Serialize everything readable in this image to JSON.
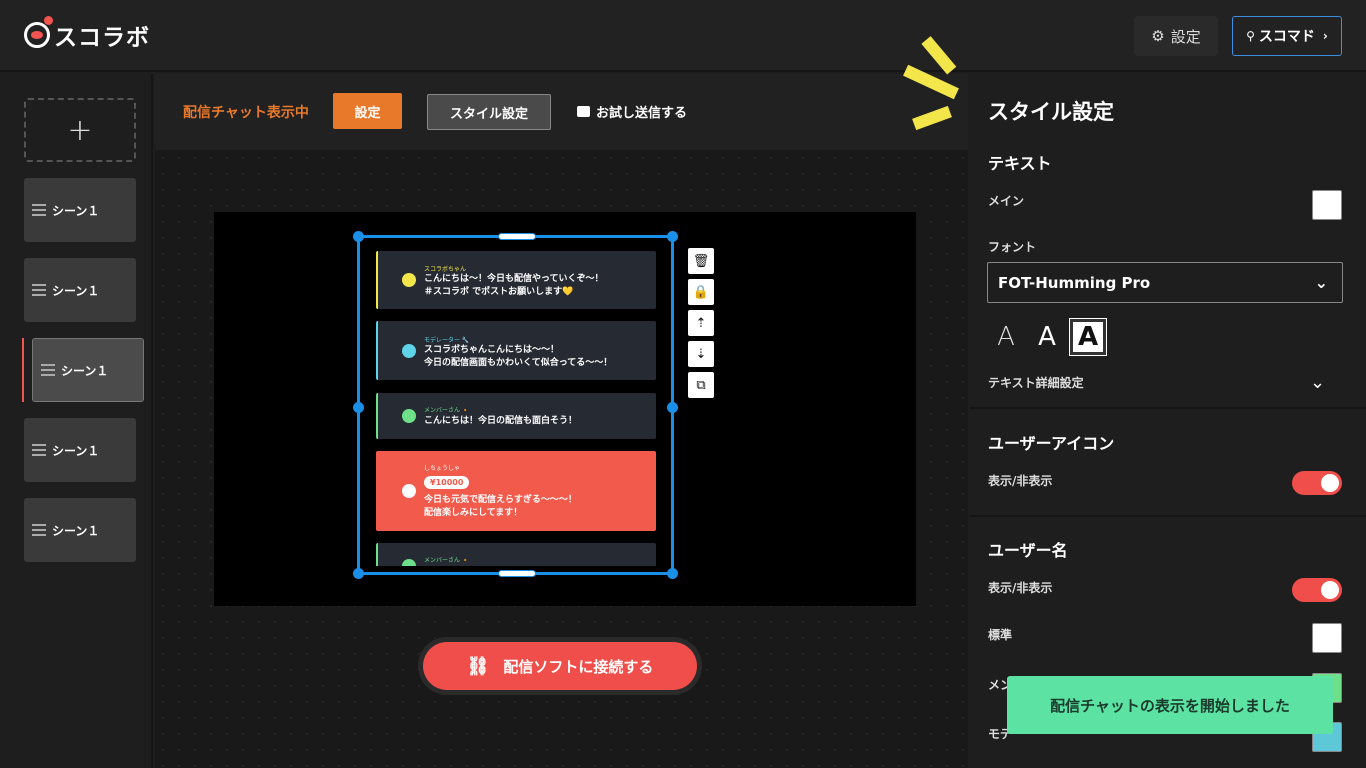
{
  "header": {
    "logo_text": "スコラボ",
    "settings_label": "設定",
    "scmd_label": "スコマド"
  },
  "sidebar": {
    "add_label": "+",
    "scenes": [
      {
        "label": "シーン１"
      },
      {
        "label": "シーン１"
      },
      {
        "label": "シーン１",
        "active": true
      },
      {
        "label": "シーン１"
      },
      {
        "label": "シーン１"
      }
    ]
  },
  "toolbar": {
    "status": "配信チャット表示中",
    "settings_label": "設定",
    "style_label": "スタイル設定",
    "test_send_label": "お試し送信する"
  },
  "preview": {
    "messages": [
      {
        "user": "スコラボちゃん",
        "user_color": "#f3e64a",
        "dot_color": "#f3e64a",
        "border": "#f3e64a",
        "lines": [
          "こんにちは～！今日も配信やっていくぞ～！",
          "＃スコラボ でポストお願いします💛"
        ]
      },
      {
        "user": "モデレーター 🔧",
        "user_color": "#5fd3e8",
        "dot_color": "#5fd3e8",
        "border": "#5fd3e8",
        "lines": [
          "スコラボちゃんこんにちは～～！",
          "今日の配信画面もかわいくて似合ってる～～！"
        ]
      },
      {
        "user": "メンバーさん 🔸",
        "user_color": "#6ee08a",
        "dot_color": "#6ee08a",
        "border": "#6ee08a",
        "lines": [
          "こんにちは！今日の配信も面白そう！"
        ]
      },
      {
        "user": "しちょうしゃ",
        "amount": "¥10000",
        "lines": [
          "今日も元気で配信えらすぎる～～～！",
          "配信楽しみにしてます！"
        ]
      },
      {
        "user": "メンバーさん 🔸",
        "user_color": "#6ee08a",
        "dot_color": "#6ee08a",
        "border": "#6ee08a",
        "lines": []
      }
    ],
    "tools": [
      "trash-icon",
      "lock-icon",
      "bring-forward-icon",
      "send-backward-icon",
      "duplicate-icon"
    ]
  },
  "connect": {
    "label": "配信ソフトに接続する"
  },
  "panel": {
    "title": "スタイル設定",
    "text_section": "テキスト",
    "main_label": "メイン",
    "font_label": "フォント",
    "font_value": "FOT-Humming Pro",
    "weights": [
      "A",
      "A",
      "A"
    ],
    "text_detail_label": "テキスト詳細設定",
    "user_icon_section": "ユーザーアイコン",
    "user_icon_toggle_label": "表示/非表示",
    "user_name_section": "ユーザー名",
    "user_name_toggle_label": "表示/非表示",
    "standard_label": "標準",
    "member_label": "メン",
    "moderator_label": "モデ",
    "colors": {
      "main": "#ffffff",
      "standard": "#ffffff",
      "member": "#6ee08a",
      "moderator": "#5fc8d8",
      "accent": "#f04e4a",
      "orange": "#e8782a"
    }
  },
  "toast": {
    "message": "配信チャットの表示を開始しました"
  }
}
